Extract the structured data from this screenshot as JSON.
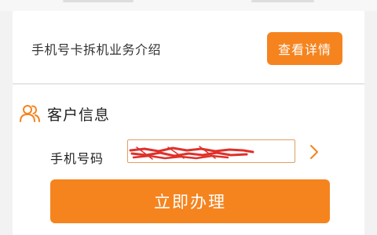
{
  "service_info": {
    "text": "手机号卡拆机业务介绍",
    "detail_button_label": "查看详情"
  },
  "customer_section": {
    "icon": "users-icon",
    "title": "客户信息"
  },
  "phone_field": {
    "label": "手机号码",
    "value": "",
    "value_state": "redacted"
  },
  "submit": {
    "label": "立即办理"
  },
  "colors": {
    "accent": "#f5841f",
    "page_background": "#f2f2f2",
    "card_background": "#ffffff",
    "redaction": "#e0302a"
  }
}
